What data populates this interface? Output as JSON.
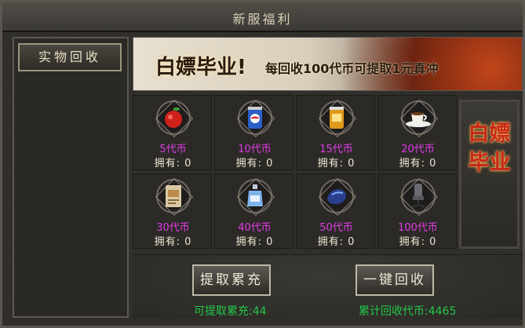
{
  "window": {
    "title": "新服福利"
  },
  "sidebar": {
    "tabs": [
      {
        "label": "实物回收"
      }
    ]
  },
  "banner": {
    "title": "白嫖毕业!",
    "subtitle": "每回收100代币可提取1元真冲"
  },
  "items": [
    {
      "icon": "apple-icon",
      "price": "5代币",
      "owned": "拥有: 0"
    },
    {
      "icon": "soda-can-icon",
      "price": "10代币",
      "owned": "拥有: 0"
    },
    {
      "icon": "beer-can-icon",
      "price": "15代币",
      "owned": "拥有: 0"
    },
    {
      "icon": "coffee-cup-icon",
      "price": "20代币",
      "owned": "拥有: 0"
    },
    {
      "icon": "card-icon",
      "price": "30代币",
      "owned": "拥有: 0"
    },
    {
      "icon": "perfume-bottle-icon",
      "price": "40代币",
      "owned": "拥有: 0"
    },
    {
      "icon": "mouse-icon",
      "price": "50代币",
      "owned": "拥有: 0"
    },
    {
      "icon": "gaming-chair-icon",
      "price": "100代币",
      "owned": "拥有: 0"
    }
  ],
  "plaque": {
    "text": "白嫖毕业"
  },
  "actions": {
    "withdraw_label": "提取累充",
    "recycle_all_label": "一键回收"
  },
  "stats": {
    "withdrawable": "可提取累充:44",
    "total_recycled": "累计回收代币:4465"
  },
  "colors": {
    "price": "#e23be8",
    "stat": "#22c84a",
    "plaque": "#c8281a"
  }
}
